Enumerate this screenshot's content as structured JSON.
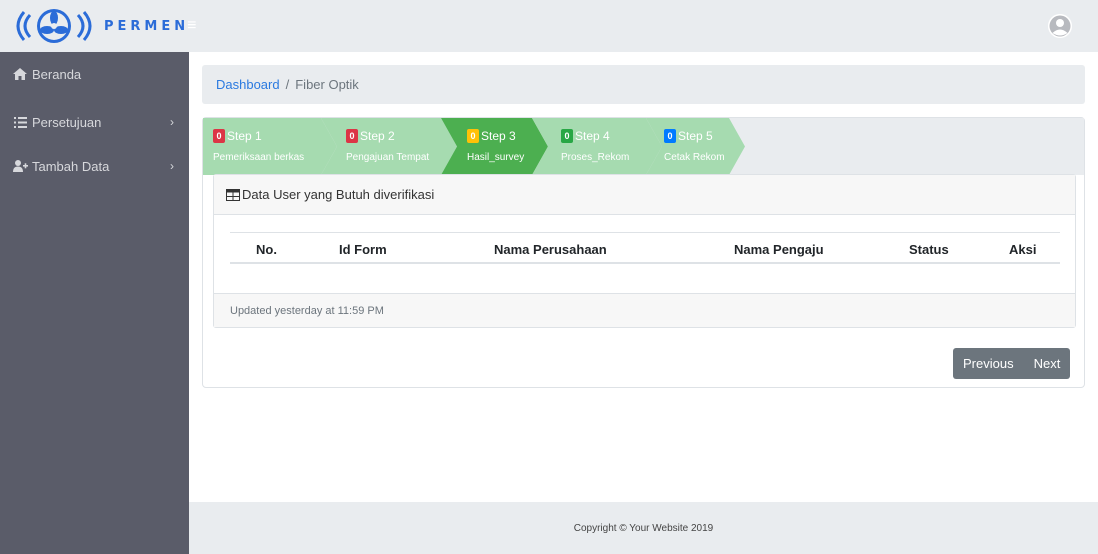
{
  "app": {
    "logo_text": "PERMEN",
    "hamburger_glyph": "≡"
  },
  "sidebar": {
    "items": [
      {
        "label": "Beranda",
        "icon": "home-icon"
      },
      {
        "label": "Persetujuan",
        "icon": "list-icon",
        "chevron": "›"
      },
      {
        "label": "Tambah Data",
        "icon": "user-plus-icon",
        "chevron": "›"
      }
    ]
  },
  "breadcrumb": {
    "home": "Dashboard",
    "separator": "/",
    "current": "Fiber Optik"
  },
  "steps": [
    {
      "badge": "0",
      "label": "Step 1",
      "sub": "Pemeriksaan berkas",
      "badge_color": "#dc3545"
    },
    {
      "badge": "0",
      "label": "Step 2",
      "sub": "Pengajuan Tempat",
      "badge_color": "#dc3545"
    },
    {
      "badge": "0",
      "label": "Step 3",
      "sub": "Hasil_survey",
      "badge_color": "#ffc107"
    },
    {
      "badge": "0",
      "label": "Step 4",
      "sub": "Proses_Rekom",
      "badge_color": "#28a745"
    },
    {
      "badge": "0",
      "label": "Step 5",
      "sub": "Cetak Rekom",
      "badge_color": "#007bff"
    }
  ],
  "table_card": {
    "title": "Data User yang Butuh diverifikasi",
    "columns": [
      "No.",
      "Id Form",
      "Nama Perusahaan",
      "Nama Pengaju",
      "Status",
      "Aksi"
    ],
    "rows": [],
    "updated": "Updated yesterday at 11:59 PM"
  },
  "pager": {
    "previous": "Previous",
    "next": "Next"
  },
  "footer": {
    "text": "Copyright © Your Website 2019"
  },
  "colors": {
    "step_active": "#4caf50",
    "step_inactive": "#a6dbb0",
    "sidebar_bg": "#5a5c69",
    "link": "#2b7ae0"
  }
}
